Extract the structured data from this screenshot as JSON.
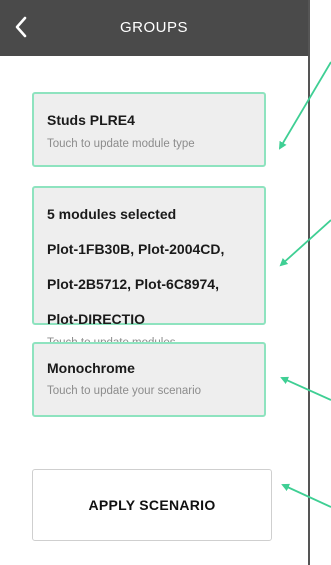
{
  "header": {
    "title": "GROUPS",
    "back_icon": "chevron-left-icon"
  },
  "cards": {
    "module_type": {
      "value": "Studs PLRE4",
      "hint": "Touch to update module type"
    },
    "modules": {
      "lines": [
        "5 modules selected",
        "Plot-1FB30B, Plot-2004CD,",
        "Plot-2B5712, Plot-6C8974,",
        "Plot-DIRECTIO"
      ],
      "hint": "Touch to update modules"
    },
    "scenario": {
      "value": "Monochrome",
      "hint": "Touch to update your scenario"
    }
  },
  "apply_button": {
    "label": "APPLY SCENARIO"
  },
  "colors": {
    "header_bg": "#4a4a4a",
    "card_bg": "#eeeeee",
    "card_border": "#8ee3bf",
    "annotation_arrow": "#3fcf94"
  }
}
